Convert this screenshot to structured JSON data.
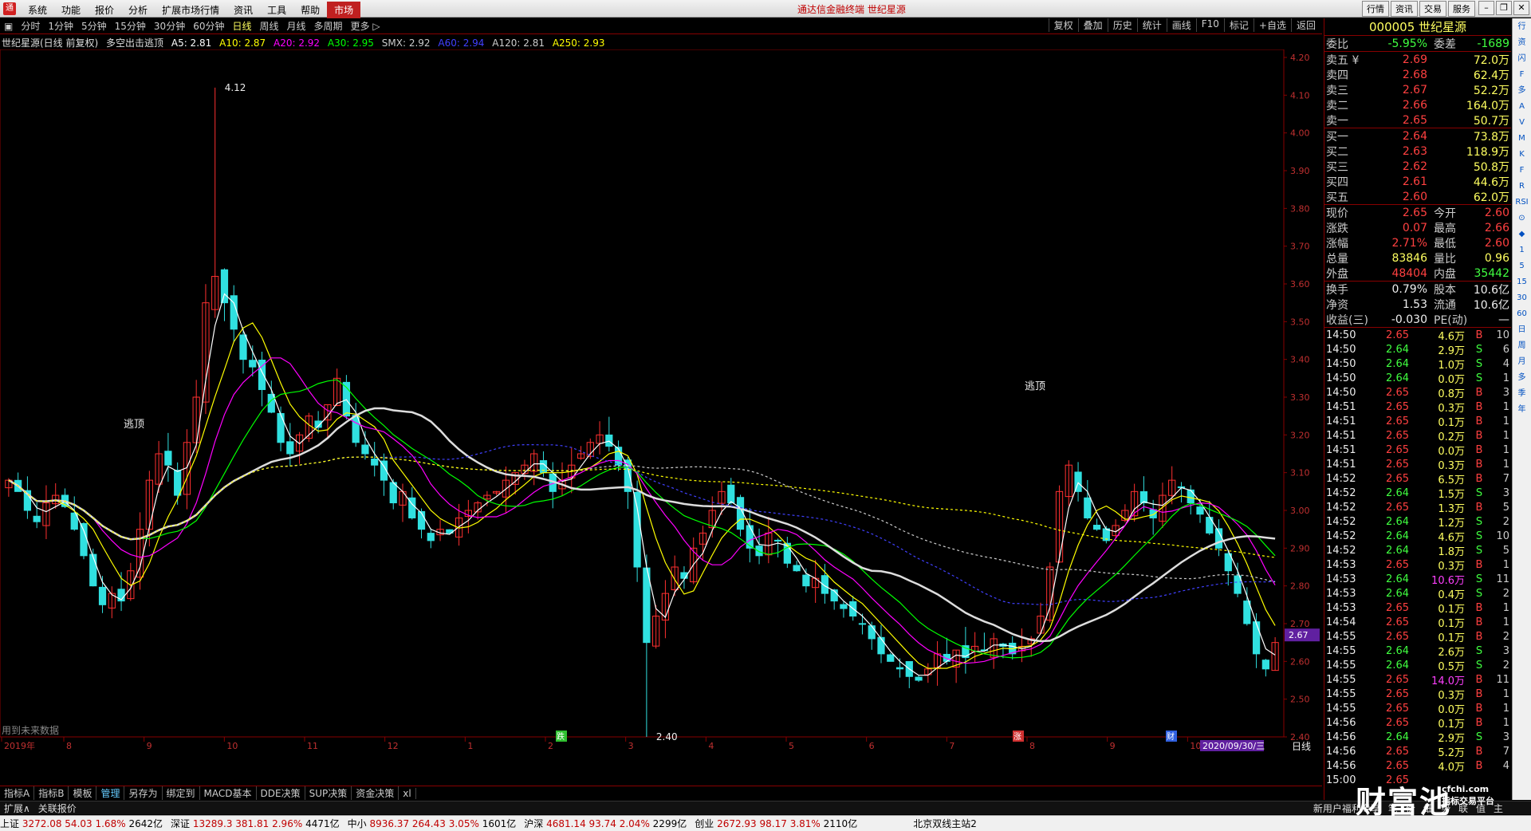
{
  "titlebar": {
    "menu": [
      "系统",
      "功能",
      "报价",
      "分析",
      "扩展市场行情",
      "资讯",
      "工具",
      "帮助",
      "市场"
    ],
    "center": "通达信金融终端 世纪星源",
    "buttons": [
      "行情",
      "资讯",
      "交易",
      "服务"
    ]
  },
  "periods": [
    "分时",
    "1分钟",
    "5分钟",
    "15分钟",
    "30分钟",
    "60分钟",
    "日线",
    "周线",
    "月线",
    "多周期",
    "更多 ▷"
  ],
  "tools": [
    "复权",
    "叠加",
    "历史",
    "统计",
    "画线",
    "F10",
    "标记",
    "+自选",
    "返回"
  ],
  "legend": {
    "name": "世纪星源(日线 前复权)",
    "indicator": "多空出击逃顶",
    "items": [
      {
        "t": "A5: 2.81",
        "c": "#ffffff"
      },
      {
        "t": "A10: 2.87",
        "c": "#ffff00"
      },
      {
        "t": "A20: 2.92",
        "c": "#ff00ff"
      },
      {
        "t": "A30: 2.95",
        "c": "#00ff00"
      },
      {
        "t": "SMX: 2.92",
        "c": "#cccccc"
      },
      {
        "t": "A60: 2.94",
        "c": "#4040ff"
      },
      {
        "t": "A120: 2.81",
        "c": "#cccccc"
      },
      {
        "t": "A250: 2.93",
        "c": "#ffff00"
      }
    ]
  },
  "chart_labels": {
    "high": "4.12",
    "low": "2.40",
    "escape1": "逃顶",
    "escape2": "逃顶",
    "cur": "2.67",
    "future": "用到未来数据",
    "date": "2020/09/30/三",
    "period": "日线",
    "mark1": "跌",
    "mark2": "涨",
    "mark3": "财"
  },
  "chart_data": {
    "type": "candlestick",
    "ylim": [
      2.4,
      4.2
    ],
    "yticks": [
      "4.20",
      "4.10",
      "4.00",
      "3.90",
      "3.80",
      "3.70",
      "3.60",
      "3.50",
      "3.40",
      "3.30",
      "3.20",
      "3.10",
      "3.00",
      "2.90",
      "2.80",
      "2.70",
      "2.60",
      "2.50",
      "2.40"
    ],
    "xlabels": [
      "2019年",
      "8",
      "9",
      "10",
      "11",
      "12",
      "1",
      "2",
      "3",
      "4",
      "5",
      "6",
      "7",
      "8",
      "9",
      "10"
    ],
    "closes": [
      3.08,
      3.05,
      3.0,
      2.97,
      3.02,
      3.04,
      3.01,
      2.95,
      2.88,
      2.8,
      2.75,
      2.78,
      2.76,
      2.84,
      2.95,
      3.08,
      3.15,
      3.12,
      3.04,
      3.18,
      3.3,
      3.55,
      3.62,
      3.55,
      3.48,
      3.4,
      3.38,
      3.32,
      3.26,
      3.18,
      3.15,
      3.2,
      3.25,
      3.22,
      3.28,
      3.35,
      3.25,
      3.18,
      3.15,
      3.12,
      3.08,
      3.02,
      3.05,
      2.98,
      2.95,
      2.92,
      2.95,
      2.94,
      2.98,
      3.0,
      3.02,
      3.04,
      3.05,
      3.08,
      3.1,
      3.12,
      3.15,
      3.1,
      3.05,
      3.08,
      3.12,
      3.15,
      3.18,
      3.2,
      3.17,
      3.12,
      3.05,
      2.85,
      2.65,
      2.72,
      2.78,
      2.85,
      2.82,
      2.9,
      2.94,
      3.0,
      3.05,
      3.02,
      2.95,
      2.9,
      2.88,
      2.94,
      2.92,
      2.86,
      2.84,
      2.8,
      2.82,
      2.78,
      2.76,
      2.74,
      2.72,
      2.7,
      2.66,
      2.62,
      2.6,
      2.58,
      2.56,
      2.55,
      2.58,
      2.62,
      2.6,
      2.63,
      2.61,
      2.64,
      2.63,
      2.66,
      2.64,
      2.62,
      2.64,
      2.66,
      2.72,
      2.85,
      3.05,
      3.12,
      3.05,
      2.98,
      2.95,
      2.92,
      2.96,
      3.0,
      3.05,
      3.02,
      2.98,
      3.04,
      3.08,
      3.06,
      3.02,
      2.99,
      2.94,
      2.9,
      2.84,
      2.78,
      2.7,
      2.62,
      2.58,
      2.65
    ],
    "vol": [
      "83846"
    ]
  },
  "quote": {
    "code": "000005 世纪星源",
    "weibi": "-5.95%",
    "weicha": "-1689",
    "asks": [
      {
        "l": "卖五 ¥",
        "p": "2.69",
        "v": "72.0万"
      },
      {
        "l": "卖四",
        "p": "2.68",
        "v": "62.4万"
      },
      {
        "l": "卖三",
        "p": "2.67",
        "v": "52.2万"
      },
      {
        "l": "卖二",
        "p": "2.66",
        "v": "164.0万"
      },
      {
        "l": "卖一",
        "p": "2.65",
        "v": "50.7万"
      }
    ],
    "bids": [
      {
        "l": "买一",
        "p": "2.64",
        "v": "73.8万"
      },
      {
        "l": "买二",
        "p": "2.63",
        "v": "118.9万"
      },
      {
        "l": "买三",
        "p": "2.62",
        "v": "50.8万"
      },
      {
        "l": "买四",
        "p": "2.61",
        "v": "44.6万"
      },
      {
        "l": "买五",
        "p": "2.60",
        "v": "62.0万"
      }
    ],
    "stats": [
      {
        "l": "现价",
        "v": "2.65",
        "vc": "red",
        "l2": "今开",
        "v2": "2.60",
        "v2c": "red"
      },
      {
        "l": "涨跌",
        "v": "0.07",
        "vc": "red",
        "l2": "最高",
        "v2": "2.66",
        "v2c": "red"
      },
      {
        "l": "涨幅",
        "v": "2.71%",
        "vc": "red",
        "l2": "最低",
        "v2": "2.60",
        "v2c": "red"
      },
      {
        "l": "总量",
        "v": "83846",
        "vc": "yellow",
        "l2": "量比",
        "v2": "0.96",
        "v2c": "yellow"
      },
      {
        "l": "外盘",
        "v": "48404",
        "vc": "red",
        "l2": "内盘",
        "v2": "35442",
        "v2c": "green"
      }
    ],
    "stats2": [
      {
        "l": "换手",
        "v": "0.79%",
        "vc": "white",
        "l2": "股本",
        "v2": "10.6亿",
        "v2c": "white"
      },
      {
        "l": "净资",
        "v": "1.53",
        "vc": "white",
        "l2": "流通",
        "v2": "10.6亿",
        "v2c": "white"
      },
      {
        "l": "收益(三)",
        "v": "-0.030",
        "vc": "white",
        "l2": "PE(动)",
        "v2": "—",
        "v2c": "white"
      }
    ],
    "ticks": [
      {
        "t": "14:50",
        "p": "2.65",
        "q": "4.6万",
        "b": "B",
        "n": "10"
      },
      {
        "t": "14:50",
        "p": "2.64",
        "q": "2.9万",
        "b": "S",
        "n": "6"
      },
      {
        "t": "14:50",
        "p": "2.64",
        "q": "1.0万",
        "b": "S",
        "n": "4"
      },
      {
        "t": "14:50",
        "p": "2.64",
        "q": "0.0万",
        "b": "S",
        "n": "1"
      },
      {
        "t": "14:50",
        "p": "2.65",
        "q": "0.8万",
        "b": "B",
        "n": "3"
      },
      {
        "t": "14:51",
        "p": "2.65",
        "q": "0.3万",
        "b": "B",
        "n": "1"
      },
      {
        "t": "14:51",
        "p": "2.65",
        "q": "0.1万",
        "b": "B",
        "n": "1"
      },
      {
        "t": "14:51",
        "p": "2.65",
        "q": "0.2万",
        "b": "B",
        "n": "1"
      },
      {
        "t": "14:51",
        "p": "2.65",
        "q": "0.0万",
        "b": "B",
        "n": "1"
      },
      {
        "t": "14:51",
        "p": "2.65",
        "q": "0.3万",
        "b": "B",
        "n": "1"
      },
      {
        "t": "14:52",
        "p": "2.65",
        "q": "6.5万",
        "b": "B",
        "n": "7"
      },
      {
        "t": "14:52",
        "p": "2.64",
        "q": "1.5万",
        "b": "S",
        "n": "3"
      },
      {
        "t": "14:52",
        "p": "2.65",
        "q": "1.3万",
        "b": "B",
        "n": "5"
      },
      {
        "t": "14:52",
        "p": "2.64",
        "q": "1.2万",
        "b": "S",
        "n": "2"
      },
      {
        "t": "14:52",
        "p": "2.64",
        "q": "4.6万",
        "b": "S",
        "n": "10"
      },
      {
        "t": "14:52",
        "p": "2.64",
        "q": "1.8万",
        "b": "S",
        "n": "5"
      },
      {
        "t": "14:53",
        "p": "2.65",
        "q": "0.3万",
        "b": "B",
        "n": "1"
      },
      {
        "t": "14:53",
        "p": "2.64",
        "q": "10.6万",
        "b": "S",
        "n": "11"
      },
      {
        "t": "14:53",
        "p": "2.64",
        "q": "0.4万",
        "b": "S",
        "n": "2"
      },
      {
        "t": "14:53",
        "p": "2.65",
        "q": "0.1万",
        "b": "B",
        "n": "1"
      },
      {
        "t": "14:54",
        "p": "2.65",
        "q": "0.1万",
        "b": "B",
        "n": "1"
      },
      {
        "t": "14:55",
        "p": "2.65",
        "q": "0.1万",
        "b": "B",
        "n": "2"
      },
      {
        "t": "14:55",
        "p": "2.64",
        "q": "2.6万",
        "b": "S",
        "n": "3"
      },
      {
        "t": "14:55",
        "p": "2.64",
        "q": "0.5万",
        "b": "S",
        "n": "2"
      },
      {
        "t": "14:55",
        "p": "2.65",
        "q": "14.0万",
        "b": "B",
        "n": "11"
      },
      {
        "t": "14:55",
        "p": "2.65",
        "q": "0.3万",
        "b": "B",
        "n": "1"
      },
      {
        "t": "14:55",
        "p": "2.65",
        "q": "0.0万",
        "b": "B",
        "n": "1"
      },
      {
        "t": "14:56",
        "p": "2.65",
        "q": "0.1万",
        "b": "B",
        "n": "1"
      },
      {
        "t": "14:56",
        "p": "2.64",
        "q": "2.9万",
        "b": "S",
        "n": "3"
      },
      {
        "t": "14:56",
        "p": "2.65",
        "q": "5.2万",
        "b": "B",
        "n": "7"
      },
      {
        "t": "14:56",
        "p": "2.65",
        "q": "4.0万",
        "b": "B",
        "n": "4"
      },
      {
        "t": "15:00",
        "p": "2.65",
        "q": "",
        "b": "",
        "n": ""
      }
    ]
  },
  "bottomtabs": [
    "指标A",
    "指标B",
    "模板",
    "管理",
    "另存为",
    "绑定到",
    "MACD基本",
    "DDE决策",
    "SUP决策",
    "资金决策",
    "xl"
  ],
  "extrabar": [
    "扩展∧",
    "关联报价"
  ],
  "extraright": [
    "新用户福利专享",
    "笔",
    "价",
    "细",
    "势",
    "联",
    "值",
    "主"
  ],
  "statusbar": [
    {
      "n": "上证",
      "v": "3272.08",
      "c": "54.03",
      "p": "1.68%",
      "a": "2642亿"
    },
    {
      "n": "深证",
      "v": "13289.3",
      "c": "381.81",
      "p": "2.96%",
      "a": "4471亿"
    },
    {
      "n": "中小",
      "v": "8936.37",
      "c": "264.43",
      "p": "3.05%",
      "a": "1601亿"
    },
    {
      "n": "沪深",
      "v": "4681.14",
      "c": "93.74",
      "p": "2.04%",
      "a": "2299亿"
    },
    {
      "n": "创业",
      "v": "2672.93",
      "c": "98.17",
      "p": "3.81%",
      "a": "2110亿"
    }
  ],
  "station": "北京双线主站2",
  "sidebar": [
    "行",
    "资",
    "闪",
    "F",
    "多",
    "A",
    "V",
    "M",
    "K",
    "F",
    "R",
    "RSI",
    "⊙",
    "◆",
    "1",
    "5",
    "15",
    "30",
    "60",
    "日",
    "周",
    "月",
    "多",
    "季",
    "年"
  ],
  "watermark": {
    "big": "财富池",
    "site": "cfchi.com",
    "tag": "指标交易平台"
  }
}
